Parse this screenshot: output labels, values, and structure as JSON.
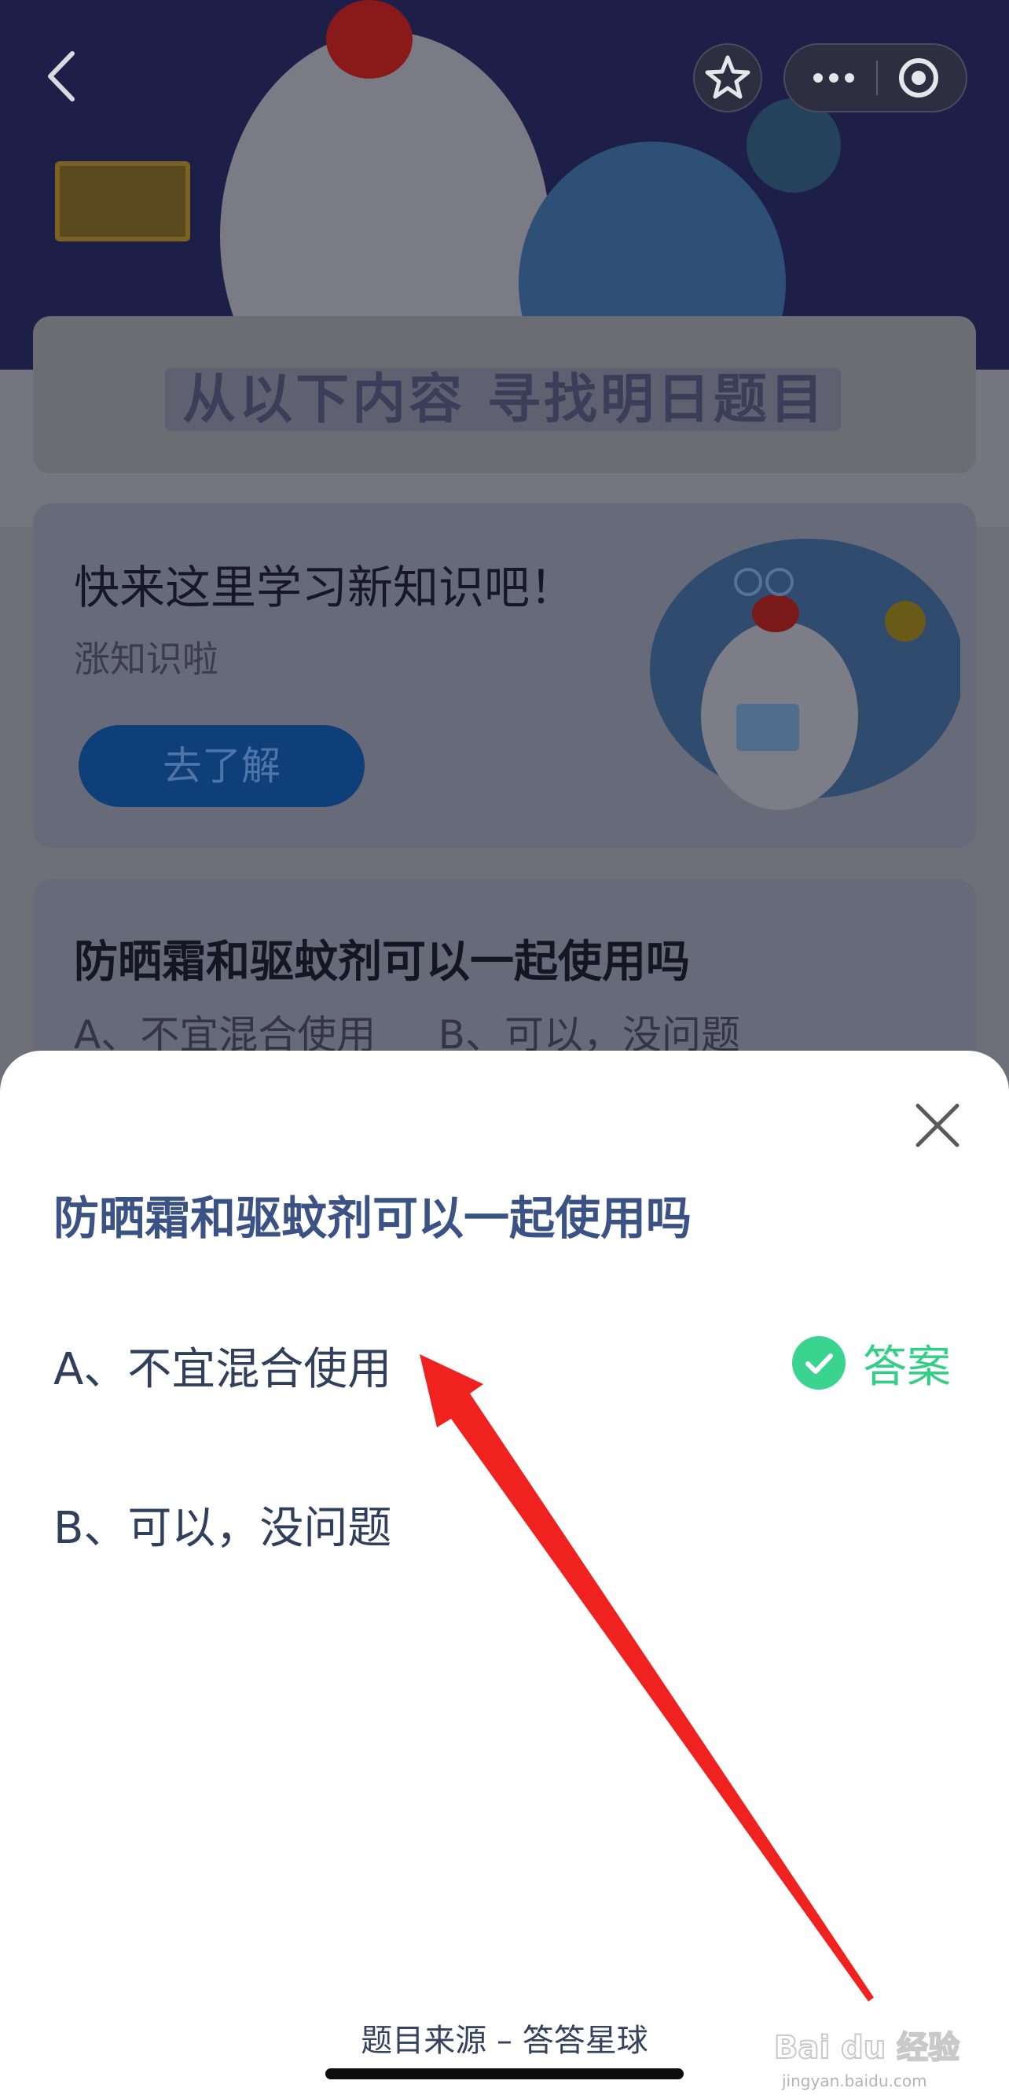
{
  "background": {
    "section_title": "从以下内容 寻找明日题目",
    "learn_card": {
      "title": "快来这里学习新知识吧！",
      "subtitle": "涨知识啦",
      "button_label": "去了解"
    },
    "question_card": {
      "title": "防晒霜和驱蚊剂可以一起使用吗",
      "options": "A、不宜混合使用     B、可以，没问题"
    }
  },
  "sheet": {
    "question": "防晒霜和驱蚊剂可以一起使用吗",
    "options": [
      {
        "label": "A、不宜混合使用",
        "is_answer": true
      },
      {
        "label": "B、可以，没问题",
        "is_answer": false
      }
    ],
    "answer_label": "答案",
    "source": "题目来源 – 答答星球"
  },
  "watermark": {
    "text": "Bai du 经验",
    "subtext": "jingyan.baidu.com"
  },
  "colors": {
    "question_blue": "#3b5284",
    "answer_green": "#33cf87",
    "arrow_red": "#f0221f"
  },
  "icons": {
    "back": "chevron-left-icon",
    "favorite": "star-icon",
    "more": "more-dots-icon",
    "close_miniapp": "target-circle-icon",
    "close_sheet": "close-x-icon",
    "answer_check": "check-circle-icon"
  }
}
